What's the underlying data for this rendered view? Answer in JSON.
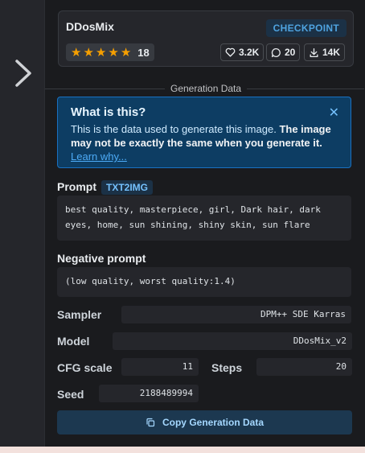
{
  "model": {
    "name": "DDosMix",
    "type_badge": "CHECKPOINT",
    "rating_stars": 5,
    "rating_count": "18",
    "likes": "3.2K",
    "comments": "20",
    "downloads": "14K"
  },
  "section_title": "Generation Data",
  "alert": {
    "title": "What is this?",
    "body_plain": "This is the data used to generate this image. ",
    "body_bold": "The image may not be exactly the same when you generate it.",
    "link": "Learn why..."
  },
  "prompt": {
    "label": "Prompt",
    "badge": "TXT2IMG",
    "text": "best quality, masterpiece, girl, Dark hair, dark eyes, home, sun shining, shiny skin, sun flare"
  },
  "negative_prompt": {
    "label": "Negative prompt",
    "text": "(low quality, worst quality:1.4)"
  },
  "params": {
    "sampler_label": "Sampler",
    "sampler": "DPM++ SDE Karras",
    "model_label": "Model",
    "model": "DDosMix_v2",
    "cfg_label": "CFG scale",
    "cfg": "11",
    "steps_label": "Steps",
    "steps": "20",
    "seed_label": "Seed",
    "seed": "2188489994"
  },
  "copy_button": "Copy Generation Data",
  "icons": {
    "nav": "chevron-right-icon",
    "star": "star-icon",
    "like": "heart-icon",
    "comment": "comment-icon",
    "download": "download-icon",
    "close": "close-icon",
    "copy": "copy-icon"
  },
  "colors": {
    "accent": "#4fa3e0",
    "star": "#f59f00",
    "alert_bg": "#0d3d63"
  }
}
